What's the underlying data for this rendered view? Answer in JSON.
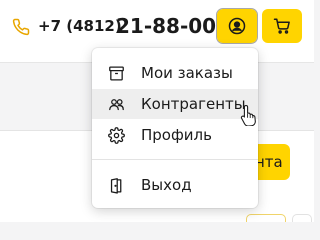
{
  "header": {
    "phone_code": "+7 (4812)",
    "phone_number": "21-88-00",
    "icons": {
      "phone": "phone-icon",
      "user": "user-icon",
      "cart": "cart-icon"
    }
  },
  "background": {
    "partial_button_text": "нта"
  },
  "dropdown": {
    "items": [
      {
        "label": "Мои заказы",
        "icon": "archive-icon"
      },
      {
        "label": "Контрагенты",
        "icon": "users-icon"
      },
      {
        "label": "Профиль",
        "icon": "gear-icon"
      },
      {
        "label": "Выход",
        "icon": "door-exit-icon"
      }
    ],
    "hovered_item": "Контрагенты"
  },
  "colors": {
    "accent": "#ffd400",
    "text": "#1b1b1b",
    "phone_icon": "#e8a600",
    "hover_bg": "#eeeeee"
  }
}
